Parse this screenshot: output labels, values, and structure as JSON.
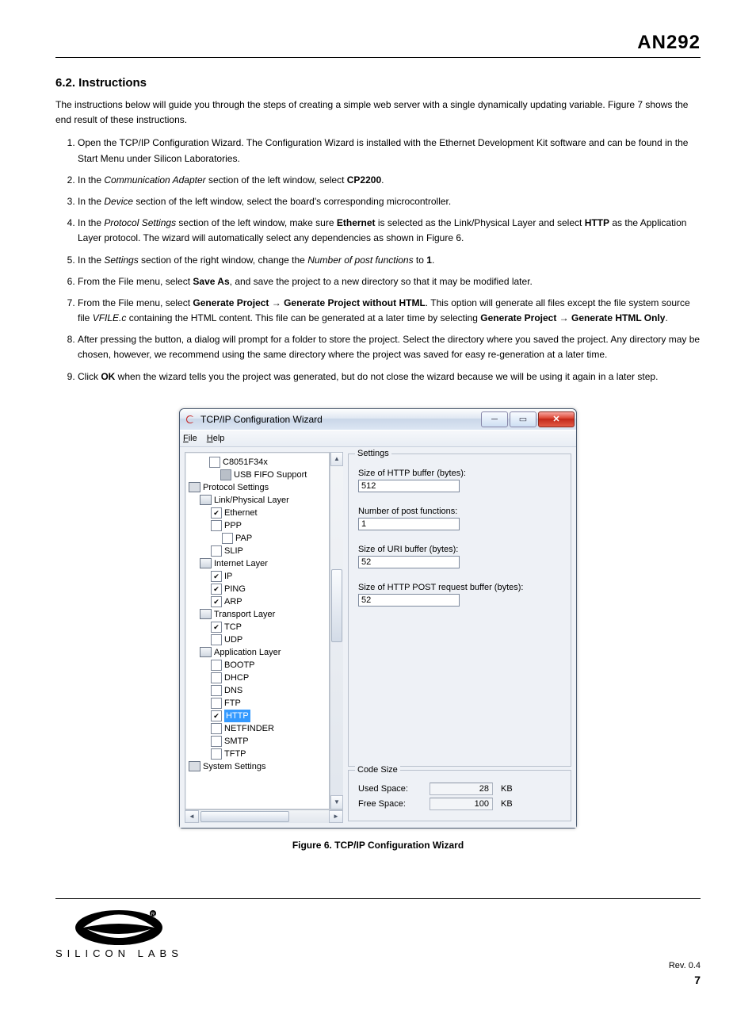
{
  "doc": {
    "title_right": "AN292",
    "heading": "6.2.  Instructions",
    "intro": "The instructions below will guide you through the steps of creating a simple web server with a single dynamically updating variable. Figure 7 shows the end result of these instructions.",
    "steps": [
      "Open the TCP/IP Configuration Wizard. The Configuration Wizard is installed with the Ethernet Development Kit software and can be found in the Start Menu under Silicon Laboratories.",
      "In the Communication Adapter section of the left window, select CP2200.",
      "In the Device section of the left window, select the board's corresponding microcontroller.",
      "In the Protocol Settings section of the left window, make sure Ethernet is selected as the Link/Physical Layer and select HTTP as the Application Layer protocol. The wizard will automatically select any dependencies as shown in Figure 6.",
      "In the Settings section of the right window, change the Number of post functions to 1.",
      "From the File menu, select Save As, and save the project to a new directory so that it may be modified later.",
      "From the File menu, select Generate Project → Generate Project without HTML. This option will generate all files except the file system source file VFILE.c containing the HTML content. This file can be generated at a later time by selecting Generate Project → Generate HTML Only.",
      "After pressing the button, a dialog will prompt for a folder to store the project. Select the directory where you saved the project. Any directory may be chosen, however, we recommend using the same directory where the project was saved for easy re-generation at a later time.",
      "Click OK when the wizard tells you the project was generated, but do not close the wizard because we will be using it again in a later step."
    ],
    "figure_caption": "Figure 6. TCP/IP Configuration Wizard",
    "footer_rev": "Rev. 0.4",
    "footer_page": "7",
    "logo_text": "SILICON LABS"
  },
  "win": {
    "title": "TCP/IP Configuration Wizard",
    "menu": {
      "file": "File",
      "help": "Help"
    },
    "tree": {
      "c8051f34x": "C8051F34x",
      "usb_fifo": "USB FIFO Support",
      "protocol_settings": "Protocol Settings",
      "link_layer": "Link/Physical Layer",
      "ethernet": "Ethernet",
      "ppp": "PPP",
      "pap": "PAP",
      "slip": "SLIP",
      "internet_layer": "Internet Layer",
      "ip": "IP",
      "ping": "PING",
      "arp": "ARP",
      "transport_layer": "Transport Layer",
      "tcp": "TCP",
      "udp": "UDP",
      "application_layer": "Application Layer",
      "bootp": "BOOTP",
      "dhcp": "DHCP",
      "dns": "DNS",
      "ftp": "FTP",
      "http": "HTTP",
      "netfinder": "NETFINDER",
      "smtp": "SMTP",
      "tftp": "TFTP",
      "system_settings": "System Settings"
    },
    "settings": {
      "group_label": "Settings",
      "http_buf_lbl": "Size of HTTP buffer (bytes):",
      "http_buf_val": "512",
      "post_fn_lbl": "Number of post functions:",
      "post_fn_val": "1",
      "uri_buf_lbl": "Size of URI buffer (bytes):",
      "uri_buf_val": "52",
      "post_req_lbl": "Size of HTTP POST request buffer (bytes):",
      "post_req_val": "52"
    },
    "codesize": {
      "group_label": "Code Size",
      "used_lbl": "Used Space:",
      "used_val": "28",
      "free_lbl": "Free Space:",
      "free_val": "100",
      "unit": "KB"
    }
  }
}
